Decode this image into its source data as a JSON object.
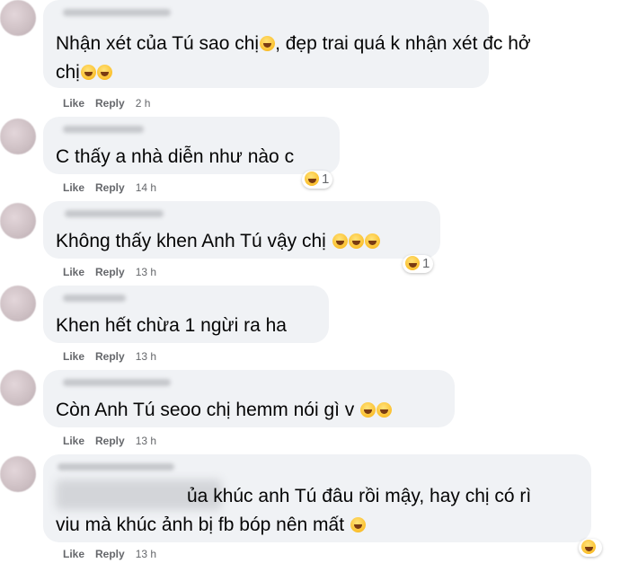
{
  "labels": {
    "like": "Like",
    "reply": "Reply"
  },
  "comments": [
    {
      "text": [
        "Nhận xét của Tú sao chị",
        ", đẹp trai quá k nhận xét đc hở",
        "chị"
      ],
      "time": "2 h"
    },
    {
      "text": [
        "C thấy a nhà diễn như nào c"
      ],
      "time": "14 h",
      "reaction": "1"
    },
    {
      "text": [
        "Không thấy khen Anh Tú vậy chị"
      ],
      "time": "13 h",
      "reaction": "1"
    },
    {
      "text": [
        "Khen hết chừa 1 ngừi ra ha"
      ],
      "time": "13 h"
    },
    {
      "text": [
        "Còn Anh Tú seoo chị hemm nói gì v"
      ],
      "time": "13 h"
    },
    {
      "text": [
        "ủa khúc anh Tú đâu rồi mậy, hay chị có rì",
        "viu mà khúc ảnh bị fb bóp nên mất"
      ],
      "time": "13 h",
      "reaction": ""
    }
  ],
  "icons": {
    "reaction": "laughing-emoji-icon",
    "avatar": "blurred-avatar"
  },
  "colors": {
    "bubble": "#f0f2f5",
    "text": "#050505",
    "meta": "#65676b"
  }
}
